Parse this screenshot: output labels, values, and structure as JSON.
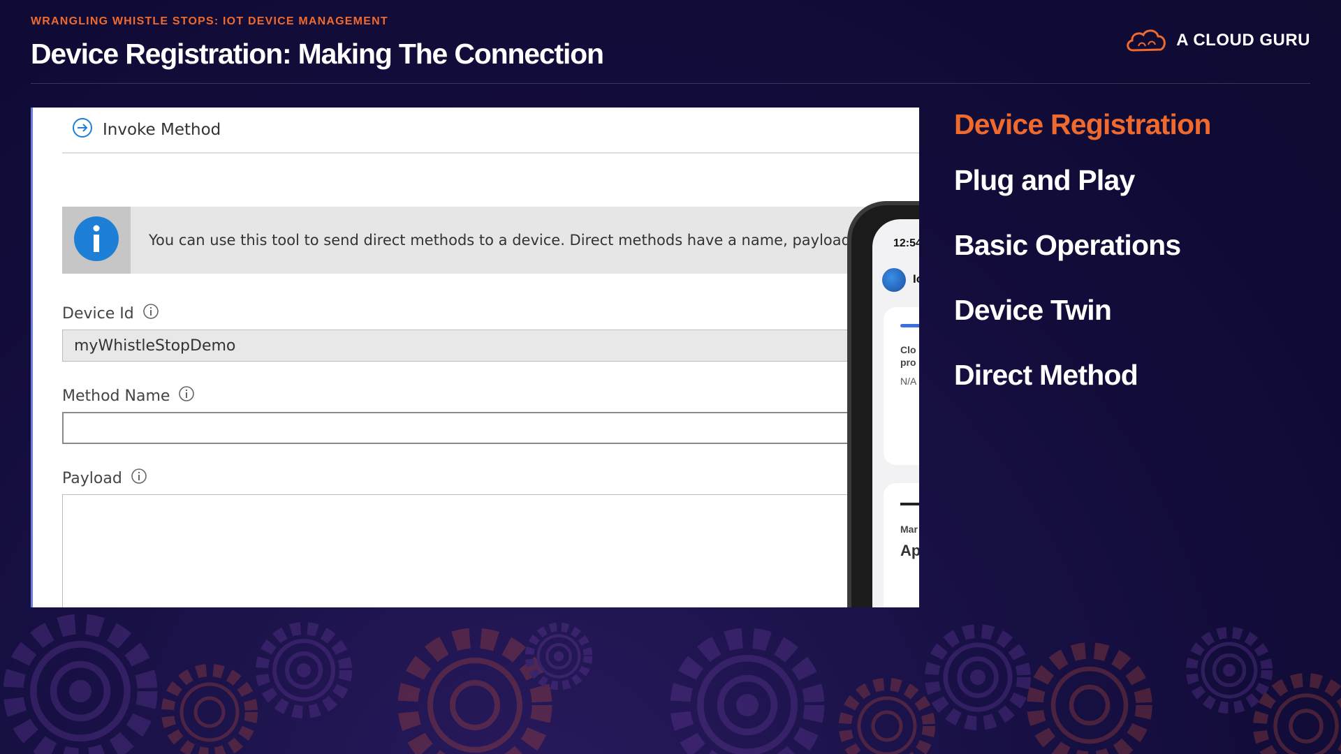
{
  "header": {
    "subtitle": "WRANGLING WHISTLE STOPS: IOT DEVICE MANAGEMENT",
    "title": "Device Registration: Making The Connection",
    "brand": "A CLOUD GURU"
  },
  "panel": {
    "invoke_label": "Invoke Method",
    "info_text": "You can use this tool to send direct methods to a device. Direct methods have a name, payload, ar",
    "device_id_label": "Device Id",
    "device_id_value": "myWhistleStopDemo",
    "method_name_label": "Method Name",
    "method_name_value": "",
    "payload_label": "Payload"
  },
  "phone": {
    "time": "12:54",
    "app_label": "Io",
    "card_title_line1": "Clo",
    "card_title_line2": "pro",
    "card_value": "N/A",
    "card2_label": "Mar",
    "card2_value": "Ap"
  },
  "topics": [
    {
      "label": "Device Registration",
      "active": true
    },
    {
      "label": "Plug and Play",
      "active": false
    },
    {
      "label": "Basic Operations",
      "active": false
    },
    {
      "label": "Device Twin",
      "active": false
    },
    {
      "label": "Direct Method",
      "active": false
    }
  ],
  "colors": {
    "accent": "#f06a2e",
    "background": "#120c3a",
    "info_blue": "#1e7fd6"
  }
}
